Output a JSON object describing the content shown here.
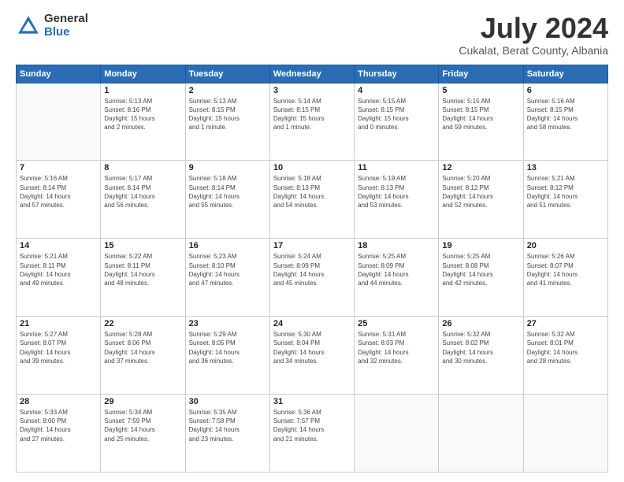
{
  "header": {
    "logo_general": "General",
    "logo_blue": "Blue",
    "title": "July 2024",
    "subtitle": "Cukalat, Berat County, Albania"
  },
  "calendar": {
    "days_of_week": [
      "Sunday",
      "Monday",
      "Tuesday",
      "Wednesday",
      "Thursday",
      "Friday",
      "Saturday"
    ],
    "weeks": [
      [
        {
          "day": "",
          "info": ""
        },
        {
          "day": "1",
          "info": "Sunrise: 5:13 AM\nSunset: 8:16 PM\nDaylight: 15 hours\nand 2 minutes."
        },
        {
          "day": "2",
          "info": "Sunrise: 5:13 AM\nSunset: 8:15 PM\nDaylight: 15 hours\nand 1 minute."
        },
        {
          "day": "3",
          "info": "Sunrise: 5:14 AM\nSunset: 8:15 PM\nDaylight: 15 hours\nand 1 minute."
        },
        {
          "day": "4",
          "info": "Sunrise: 5:15 AM\nSunset: 8:15 PM\nDaylight: 15 hours\nand 0 minutes."
        },
        {
          "day": "5",
          "info": "Sunrise: 5:15 AM\nSunset: 8:15 PM\nDaylight: 14 hours\nand 59 minutes."
        },
        {
          "day": "6",
          "info": "Sunrise: 5:16 AM\nSunset: 8:15 PM\nDaylight: 14 hours\nand 58 minutes."
        }
      ],
      [
        {
          "day": "7",
          "info": "Sunrise: 5:16 AM\nSunset: 8:14 PM\nDaylight: 14 hours\nand 57 minutes."
        },
        {
          "day": "8",
          "info": "Sunrise: 5:17 AM\nSunset: 8:14 PM\nDaylight: 14 hours\nand 56 minutes."
        },
        {
          "day": "9",
          "info": "Sunrise: 5:18 AM\nSunset: 8:14 PM\nDaylight: 14 hours\nand 55 minutes."
        },
        {
          "day": "10",
          "info": "Sunrise: 5:18 AM\nSunset: 8:13 PM\nDaylight: 14 hours\nand 54 minutes."
        },
        {
          "day": "11",
          "info": "Sunrise: 5:19 AM\nSunset: 8:13 PM\nDaylight: 14 hours\nand 53 minutes."
        },
        {
          "day": "12",
          "info": "Sunrise: 5:20 AM\nSunset: 8:12 PM\nDaylight: 14 hours\nand 52 minutes."
        },
        {
          "day": "13",
          "info": "Sunrise: 5:21 AM\nSunset: 8:12 PM\nDaylight: 14 hours\nand 51 minutes."
        }
      ],
      [
        {
          "day": "14",
          "info": "Sunrise: 5:21 AM\nSunset: 8:11 PM\nDaylight: 14 hours\nand 49 minutes."
        },
        {
          "day": "15",
          "info": "Sunrise: 5:22 AM\nSunset: 8:11 PM\nDaylight: 14 hours\nand 48 minutes."
        },
        {
          "day": "16",
          "info": "Sunrise: 5:23 AM\nSunset: 8:10 PM\nDaylight: 14 hours\nand 47 minutes."
        },
        {
          "day": "17",
          "info": "Sunrise: 5:24 AM\nSunset: 8:09 PM\nDaylight: 14 hours\nand 45 minutes."
        },
        {
          "day": "18",
          "info": "Sunrise: 5:25 AM\nSunset: 8:09 PM\nDaylight: 14 hours\nand 44 minutes."
        },
        {
          "day": "19",
          "info": "Sunrise: 5:25 AM\nSunset: 8:08 PM\nDaylight: 14 hours\nand 42 minutes."
        },
        {
          "day": "20",
          "info": "Sunrise: 5:26 AM\nSunset: 8:07 PM\nDaylight: 14 hours\nand 41 minutes."
        }
      ],
      [
        {
          "day": "21",
          "info": "Sunrise: 5:27 AM\nSunset: 8:07 PM\nDaylight: 14 hours\nand 39 minutes."
        },
        {
          "day": "22",
          "info": "Sunrise: 5:28 AM\nSunset: 8:06 PM\nDaylight: 14 hours\nand 37 minutes."
        },
        {
          "day": "23",
          "info": "Sunrise: 5:29 AM\nSunset: 8:05 PM\nDaylight: 14 hours\nand 36 minutes."
        },
        {
          "day": "24",
          "info": "Sunrise: 5:30 AM\nSunset: 8:04 PM\nDaylight: 14 hours\nand 34 minutes."
        },
        {
          "day": "25",
          "info": "Sunrise: 5:31 AM\nSunset: 8:03 PM\nDaylight: 14 hours\nand 32 minutes."
        },
        {
          "day": "26",
          "info": "Sunrise: 5:32 AM\nSunset: 8:02 PM\nDaylight: 14 hours\nand 30 minutes."
        },
        {
          "day": "27",
          "info": "Sunrise: 5:32 AM\nSunset: 8:01 PM\nDaylight: 14 hours\nand 28 minutes."
        }
      ],
      [
        {
          "day": "28",
          "info": "Sunrise: 5:33 AM\nSunset: 8:00 PM\nDaylight: 14 hours\nand 27 minutes."
        },
        {
          "day": "29",
          "info": "Sunrise: 5:34 AM\nSunset: 7:59 PM\nDaylight: 14 hours\nand 25 minutes."
        },
        {
          "day": "30",
          "info": "Sunrise: 5:35 AM\nSunset: 7:58 PM\nDaylight: 14 hours\nand 23 minutes."
        },
        {
          "day": "31",
          "info": "Sunrise: 5:36 AM\nSunset: 7:57 PM\nDaylight: 14 hours\nand 21 minutes."
        },
        {
          "day": "",
          "info": ""
        },
        {
          "day": "",
          "info": ""
        },
        {
          "day": "",
          "info": ""
        }
      ]
    ]
  }
}
